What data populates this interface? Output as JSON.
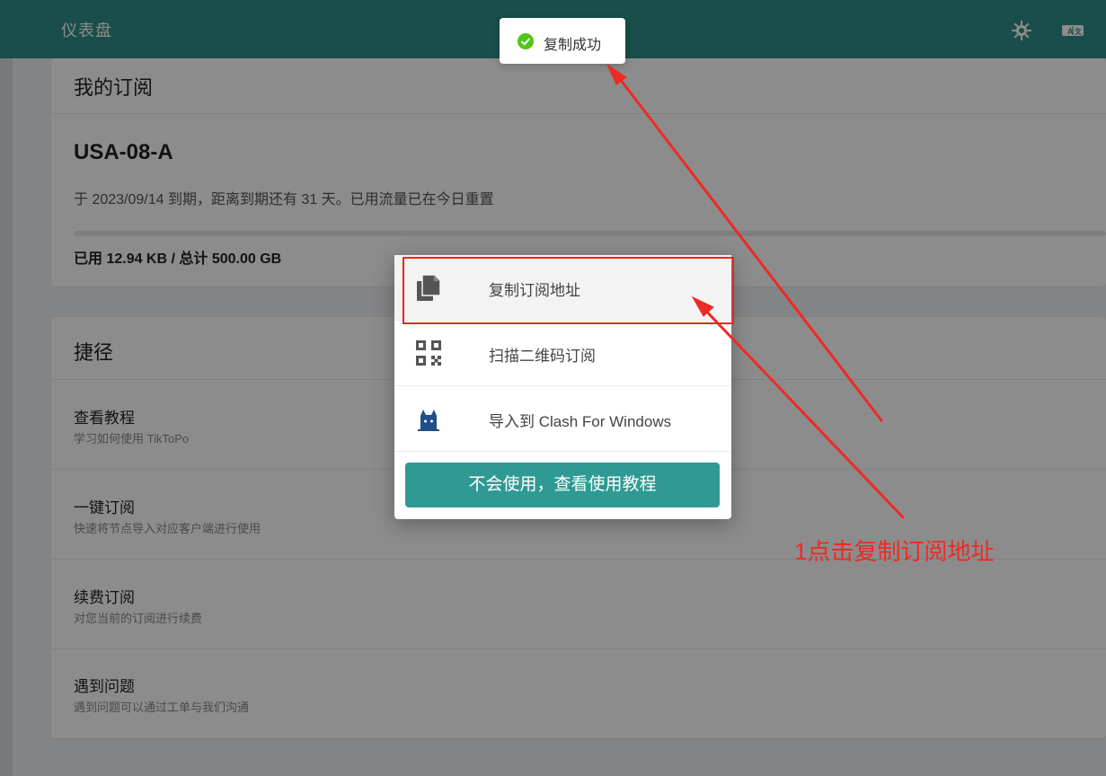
{
  "header": {
    "title": "仪表盘",
    "settings_icon": "gear-icon",
    "language_icon": "translate-icon"
  },
  "subscription": {
    "section_title": "我的订阅",
    "plan_name": "USA-08-A",
    "expire_text": "于 2023/09/14 到期，距离到期还有 31 天。已用流量已在今日重置",
    "usage_text": "已用 12.94 KB / 总计 500.00 GB",
    "usage_fraction": 0.0
  },
  "shortcuts": {
    "section_title": "捷径",
    "items": [
      {
        "title": "查看教程",
        "desc": "学习如何使用 TikToPo"
      },
      {
        "title": "一键订阅",
        "desc": "快速将节点导入对应客户端进行使用"
      },
      {
        "title": "续费订阅",
        "desc": "对您当前的订阅进行续费"
      },
      {
        "title": "遇到问题",
        "desc": "遇到问题可以通过工单与我们沟通"
      }
    ]
  },
  "menu": {
    "items": [
      {
        "label": "复制订阅地址",
        "icon": "copy-icon"
      },
      {
        "label": "扫描二维码订阅",
        "icon": "qr-code-icon"
      },
      {
        "label": "导入到 Clash For Windows",
        "icon": "clash-cat-icon"
      }
    ],
    "help_button": "不会使用，查看使用教程"
  },
  "toast": {
    "text": "复制成功",
    "icon": "check-circle-icon"
  },
  "annotation": {
    "text": "1点击复制订阅地址",
    "color": "#ec2b24"
  },
  "colors": {
    "primary": "#2f8f88",
    "button": "#2f9a93",
    "success": "#52c41a",
    "annotation_red": "#ec2b24"
  }
}
